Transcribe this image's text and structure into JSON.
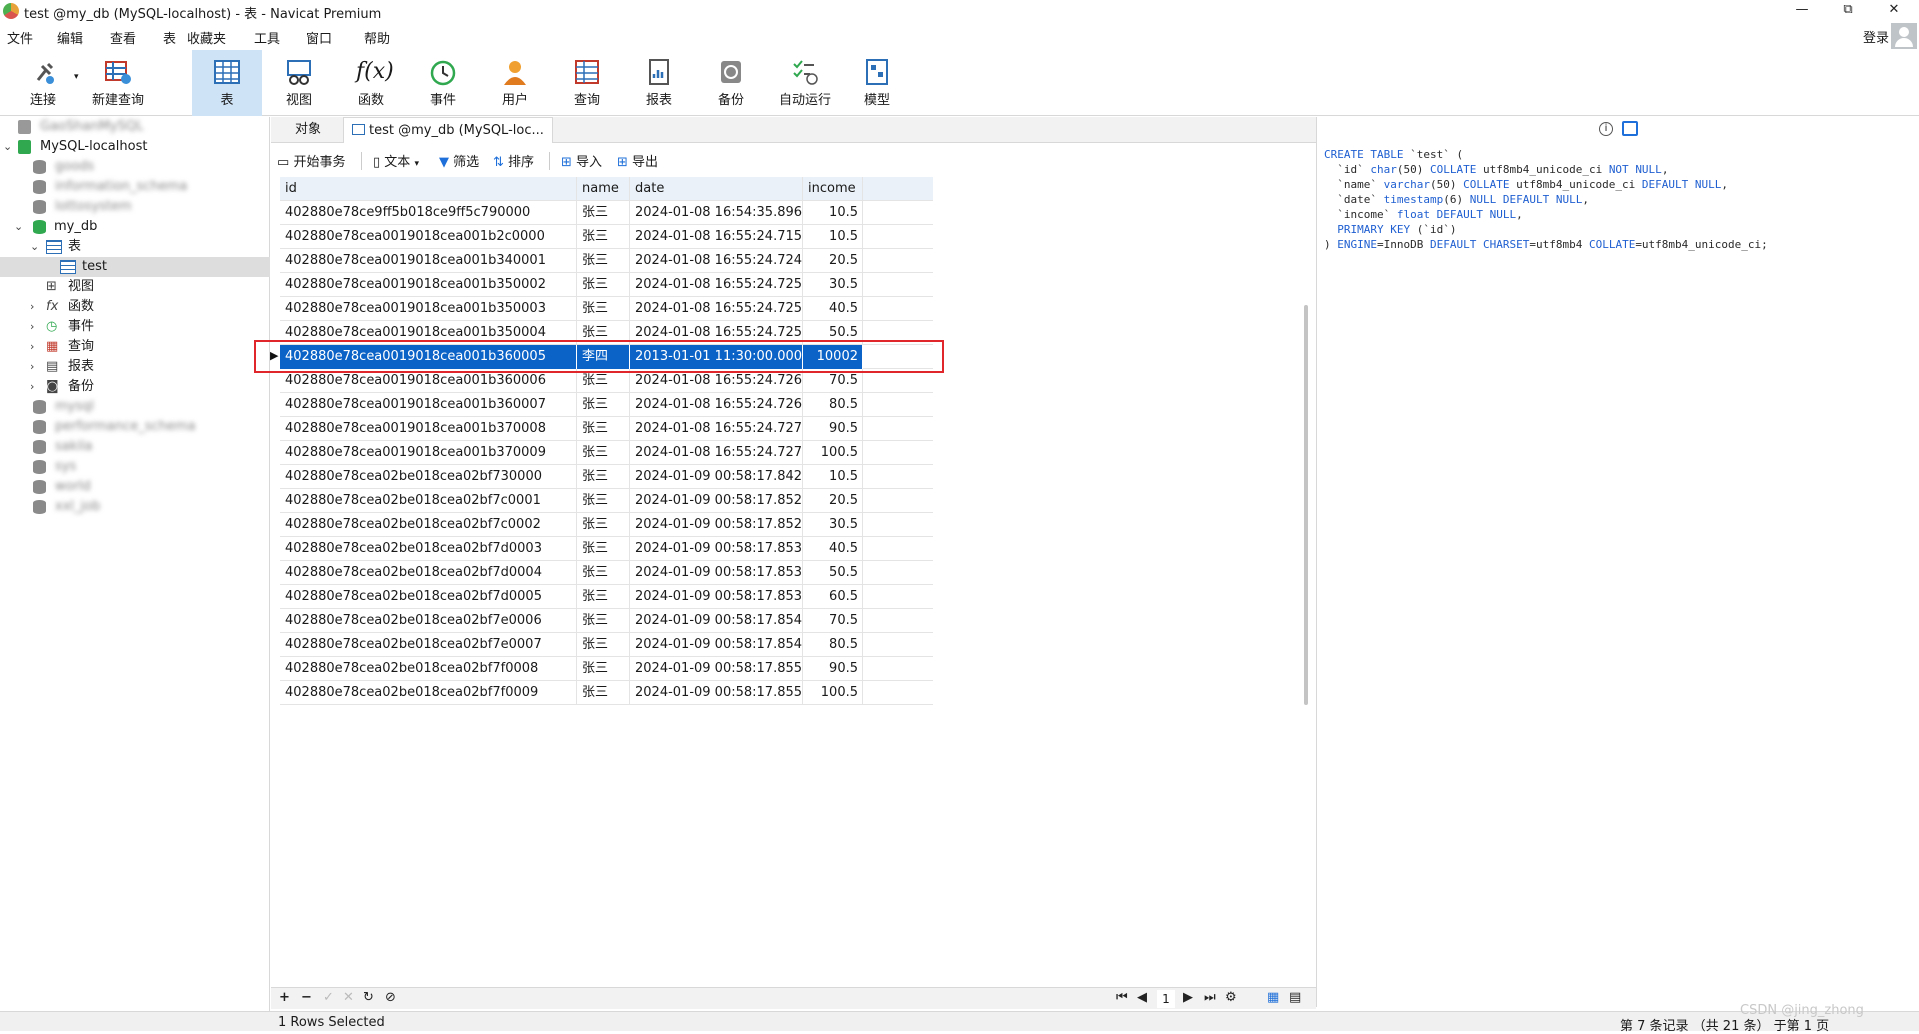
{
  "window": {
    "title": "test @my_db (MySQL-localhost) - 表 - Navicat Premium",
    "controls": {
      "minimize": "—",
      "maximize": "⧉",
      "close": "✕"
    }
  },
  "menu": {
    "items": [
      "文件",
      "编辑",
      "查看",
      "表",
      "收藏夹",
      "工具",
      "窗口",
      "帮助"
    ],
    "login": "登录"
  },
  "toolbar": {
    "items": [
      {
        "label": "连接",
        "icon": "plug-icon"
      },
      {
        "label": "新建查询",
        "icon": "new-query-icon"
      },
      {
        "label": "表",
        "icon": "table-icon",
        "active": true
      },
      {
        "label": "视图",
        "icon": "view-icon"
      },
      {
        "label": "函数",
        "icon": "function-icon"
      },
      {
        "label": "事件",
        "icon": "event-clock-icon"
      },
      {
        "label": "用户",
        "icon": "user-icon"
      },
      {
        "label": "查询",
        "icon": "query-icon"
      },
      {
        "label": "报表",
        "icon": "report-icon"
      },
      {
        "label": "备份",
        "icon": "backup-icon"
      },
      {
        "label": "自动运行",
        "icon": "automation-icon"
      },
      {
        "label": "模型",
        "icon": "model-icon"
      }
    ]
  },
  "navtree": {
    "blurred_connection": "GaoShanMySQL",
    "connection": "MySQL-localhost",
    "blurred_dbs_top": [
      "goods",
      "information_schema",
      "lottosystem"
    ],
    "active_db": "my_db",
    "tables_group": "表",
    "selected_table": "test",
    "groups": [
      "视图",
      "函数",
      "事件",
      "查询",
      "报表",
      "备份"
    ],
    "blurred_dbs_bottom": [
      "mysql",
      "performance_schema",
      "sakila",
      "sys",
      "world",
      "xxl_job"
    ]
  },
  "tabs": {
    "objects": "对象",
    "active": "test @my_db (MySQL-loc..."
  },
  "data_toolbar": {
    "begin_tx": "开始事务",
    "text": "文本",
    "filter": "筛选",
    "sort": "排序",
    "import": "导入",
    "export": "导出"
  },
  "grid": {
    "columns": [
      "id",
      "name",
      "date",
      "income"
    ],
    "selected_index": 6,
    "rows": [
      [
        "402880e78ce9ff5b018ce9ff5c790000",
        "张三",
        "2024-01-08 16:54:35.896000",
        "10.5"
      ],
      [
        "402880e78cea0019018cea001b2c0000",
        "张三",
        "2024-01-08 16:55:24.715000",
        "10.5"
      ],
      [
        "402880e78cea0019018cea001b340001",
        "张三",
        "2024-01-08 16:55:24.724000",
        "20.5"
      ],
      [
        "402880e78cea0019018cea001b350002",
        "张三",
        "2024-01-08 16:55:24.725000",
        "30.5"
      ],
      [
        "402880e78cea0019018cea001b350003",
        "张三",
        "2024-01-08 16:55:24.725000",
        "40.5"
      ],
      [
        "402880e78cea0019018cea001b350004",
        "张三",
        "2024-01-08 16:55:24.725000",
        "50.5"
      ],
      [
        "402880e78cea0019018cea001b360005",
        "李四",
        "2013-01-01 11:30:00.000000",
        "10002"
      ],
      [
        "402880e78cea0019018cea001b360006",
        "张三",
        "2024-01-08 16:55:24.726000",
        "70.5"
      ],
      [
        "402880e78cea0019018cea001b360007",
        "张三",
        "2024-01-08 16:55:24.726000",
        "80.5"
      ],
      [
        "402880e78cea0019018cea001b370008",
        "张三",
        "2024-01-08 16:55:24.727000",
        "90.5"
      ],
      [
        "402880e78cea0019018cea001b370009",
        "张三",
        "2024-01-08 16:55:24.727000",
        "100.5"
      ],
      [
        "402880e78cea02be018cea02bf730000",
        "张三",
        "2024-01-09 00:58:17.842000",
        "10.5"
      ],
      [
        "402880e78cea02be018cea02bf7c0001",
        "张三",
        "2024-01-09 00:58:17.852000",
        "20.5"
      ],
      [
        "402880e78cea02be018cea02bf7c0002",
        "张三",
        "2024-01-09 00:58:17.852000",
        "30.5"
      ],
      [
        "402880e78cea02be018cea02bf7d0003",
        "张三",
        "2024-01-09 00:58:17.853000",
        "40.5"
      ],
      [
        "402880e78cea02be018cea02bf7d0004",
        "张三",
        "2024-01-09 00:58:17.853000",
        "50.5"
      ],
      [
        "402880e78cea02be018cea02bf7d0005",
        "张三",
        "2024-01-09 00:58:17.853000",
        "60.5"
      ],
      [
        "402880e78cea02be018cea02bf7e0006",
        "张三",
        "2024-01-09 00:58:17.854000",
        "70.5"
      ],
      [
        "402880e78cea02be018cea02bf7e0007",
        "张三",
        "2024-01-09 00:58:17.854000",
        "80.5"
      ],
      [
        "402880e78cea02be018cea02bf7f0008",
        "张三",
        "2024-01-09 00:58:17.855000",
        "90.5"
      ],
      [
        "402880e78cea02be018cea02bf7f0009",
        "张三",
        "2024-01-09 00:58:17.855000",
        "100.5"
      ]
    ]
  },
  "ddl": {
    "lines": [
      "CREATE TABLE `test` (",
      "  `id` char(50) COLLATE utf8mb4_unicode_ci NOT NULL,",
      "  `name` varchar(50) COLLATE utf8mb4_unicode_ci DEFAULT NULL,",
      "  `date` timestamp(6) NULL DEFAULT NULL,",
      "  `income` float DEFAULT NULL,",
      "  PRIMARY KEY (`id`)",
      ") ENGINE=InnoDB DEFAULT CHARSET=utf8mb4 COLLATE=utf8mb4_unicode_ci;"
    ]
  },
  "record_toolbar": {
    "page": "1"
  },
  "status": {
    "left": "1 Rows Selected",
    "right": "第 7 条记录 （共 21 条） 于第 1 页",
    "watermark": "CSDN @jing_zhong"
  },
  "colors": {
    "accent": "#0c63c7",
    "highlight_frame": "#e0262a",
    "toolbar_active": "#cfe3f6"
  }
}
